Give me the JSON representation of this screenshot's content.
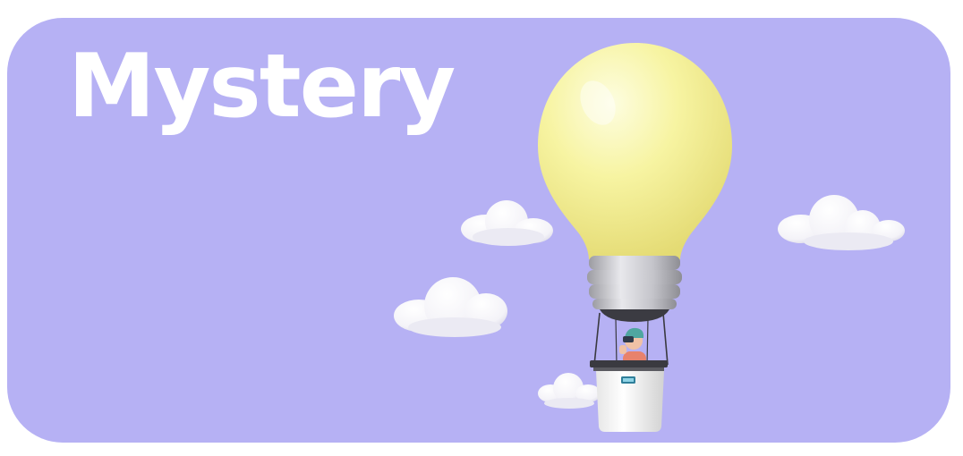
{
  "banner": {
    "title": "Mystery",
    "background_color": "#b6b1f4",
    "title_color": "#ffffff"
  },
  "illustration": {
    "icons": [
      "lightbulb-balloon-icon",
      "cloud-icon",
      "person-with-binoculars-icon"
    ],
    "bulb_color": "#f6f39e"
  }
}
